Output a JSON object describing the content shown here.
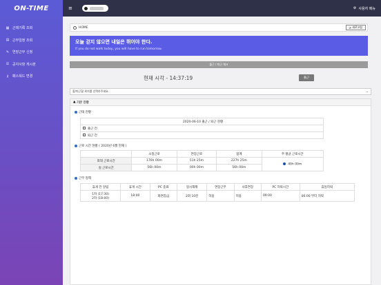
{
  "app": {
    "logo": "ON-TIME"
  },
  "sidebar": {
    "items": [
      {
        "label": "근태기록 조회",
        "icon": "calendar-icon"
      },
      {
        "label": "근무일정 조회",
        "icon": "schedule-icon"
      },
      {
        "label": "연장근무 신청",
        "icon": "edit-icon"
      },
      {
        "label": "공지사항 게시판",
        "icon": "board-icon"
      },
      {
        "label": "패스워드 변경",
        "icon": "key-icon"
      }
    ]
  },
  "topbar": {
    "menu_icon": "hamburger-icon",
    "user_menu": "사용자 메뉴"
  },
  "breadcrumb": {
    "label": "HOME",
    "refresh": "새로고침"
  },
  "banner": {
    "title": "오늘 걷지 않으면 내일은 뛰어야 한다.",
    "subtitle": "If you do not walk today, you will have to run tomorrow."
  },
  "checkbar": {
    "label": "출근 / 퇴근 체크"
  },
  "clock": {
    "label": "현재 시각 - 14:37:19",
    "button": "출근"
  },
  "location_select": {
    "placeholder": "출/퇴근할 위치를 선택하주세요."
  },
  "panel": {
    "title": "기본 현황",
    "status": {
      "title": "근태 현황",
      "date_header": "2020-06-10 출근 / 퇴근 현황",
      "rows": [
        "출근 전",
        "퇴근 전"
      ]
    },
    "summary": {
      "title": "근로 시간 현황 ( 2020년 6월 현재 )",
      "headers": [
        "",
        "소정근로",
        "연장근로",
        "합계",
        "주 평균 근로시간"
      ],
      "rows": [
        {
          "label": "최대 근로시간",
          "values": [
            "176h 00m",
            "51h 25m",
            "227h 25m"
          ]
        },
        {
          "label": "실 근로시간",
          "values": [
            "56h 00m",
            "00h 00m",
            "56h 00m"
          ]
        }
      ],
      "avg": "40h 00m"
    },
    "work": {
      "title": "근무 정책",
      "headers": [
        "휴게 전 알림",
        "휴게 시간",
        "PC 종료",
        "일시해제",
        "연장근무",
        "사후연장",
        "PC 허락시간",
        "휴일허락"
      ],
      "row": [
        "1차 (17:30)",
        "2차 (18:00)",
        "18:00",
        "화면잠금",
        "2회 10분",
        "허용",
        "허용",
        "09:00",
        "06:00 부터 허락"
      ]
    }
  },
  "colors": {
    "sidebar_top": "#5b5bd6",
    "sidebar_bottom": "#7b44b5",
    "banner": "#5a5ce6",
    "topbar": "#2e3147"
  }
}
